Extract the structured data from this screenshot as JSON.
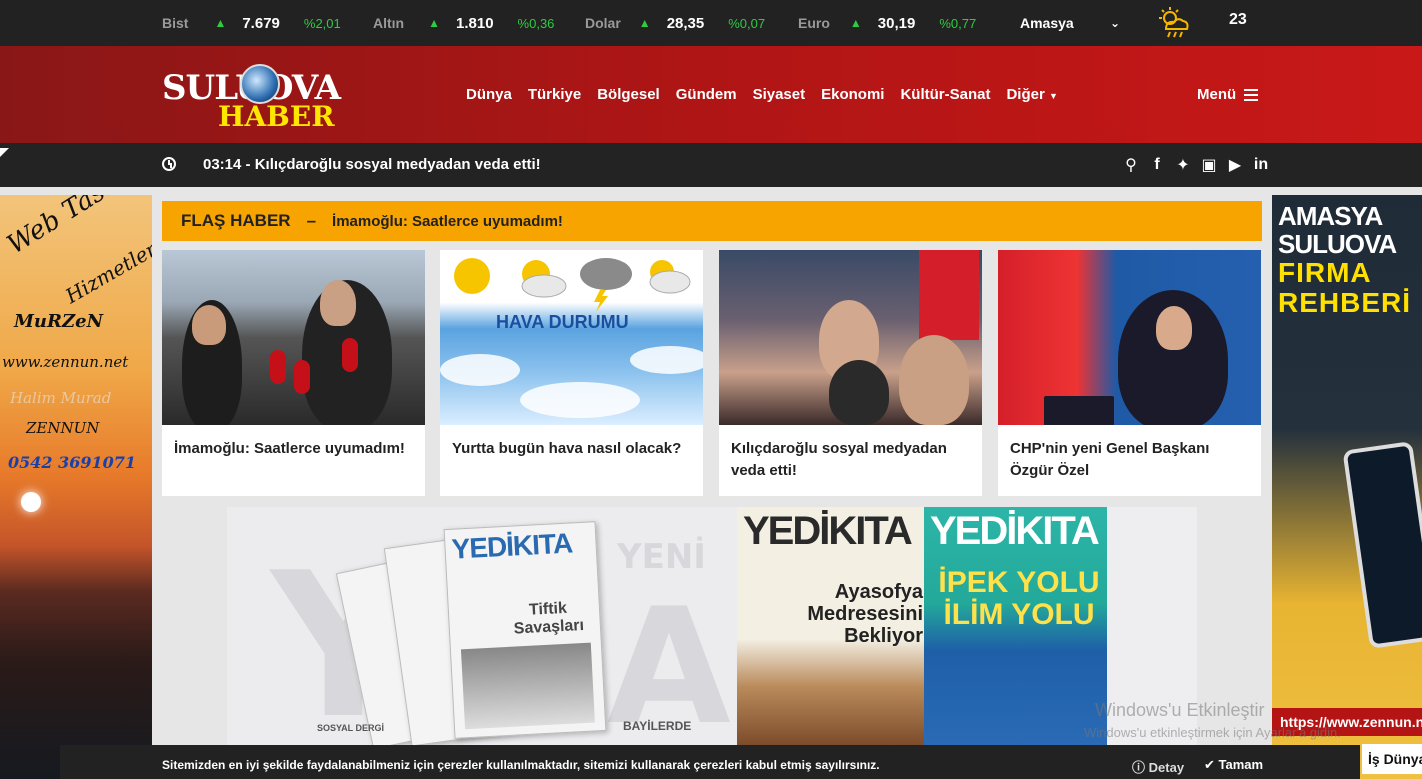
{
  "ticker": [
    {
      "label": "Bist",
      "value": "7.679",
      "change": "%2,01"
    },
    {
      "label": "Altın",
      "value": "1.810",
      "change": "%0,36"
    },
    {
      "label": "Dolar",
      "value": "28,35",
      "change": "%0,07"
    },
    {
      "label": "Euro",
      "value": "30,19",
      "change": "%0,77"
    }
  ],
  "city": "Amasya",
  "temperature": "23",
  "logo": {
    "line1": "SULUOVA",
    "line2": "HABER"
  },
  "nav": [
    "Dünya",
    "Türkiye",
    "Bölgesel",
    "Gündem",
    "Siyaset",
    "Ekonomi",
    "Kültür-Sanat",
    "Diğer"
  ],
  "menu_label": "Menü",
  "breaking": "03:14 - Kılıçdaroğlu sosyal medyadan veda etti!",
  "flash": {
    "label": "FLAŞ HABER",
    "dash": "–",
    "headline": "İmamoğlu: Saatlerce uyumadım!"
  },
  "cards": [
    {
      "title": "İmamoğlu: Saatlerce uyumadım!"
    },
    {
      "title": "Yurtta bugün hava nasıl olacak?",
      "image_text": "HAVA DURUMU"
    },
    {
      "title": "Kılıçdaroğlu sosyal medyadan veda etti!"
    },
    {
      "title": "CHP'nin yeni Genel Başkanı Özgür Özel"
    }
  ],
  "ad_left": {
    "line1": "Web Tasarım",
    "line2": "Hizmetleri",
    "brand": "MuRZeN",
    "site": "www.zennun.net",
    "name1": "Halim Murad",
    "name2": "ZENNUN",
    "phone": "0542 3691071"
  },
  "ad_right": {
    "line1": "AMASYA",
    "line2": "SULUOVA",
    "line3": "FIRMA",
    "line4": "REHBERİ",
    "url": "https://www.zennun.net"
  },
  "ad_right_extra": "İş Dünyası",
  "banner": {
    "brand": "YEDİKITA",
    "mag1_title": "Tiftik Savaşları",
    "cover_a_title": "Ayasofya Medresesini Bekliyor",
    "cover_b_title": "İPEK YOLU İLİM YOLU",
    "bayi": "BAYİLERDE",
    "sosyal": "SOSYAL DERGİ",
    "bg_word": "YENİ"
  },
  "watermark": {
    "line1": "Windows'u Etkinleştir",
    "line2": "Windows'u etkinleştirmek için Ayarlar'a gidin."
  },
  "cookie": {
    "message": "Sitemizden en iyi şekilde faydalanabilmeniz için çerezler kullanılmaktadır, sitemizi kullanarak çerezleri kabul etmiş sayılırsınız.",
    "detail": "Detay",
    "ok": "Tamam"
  }
}
